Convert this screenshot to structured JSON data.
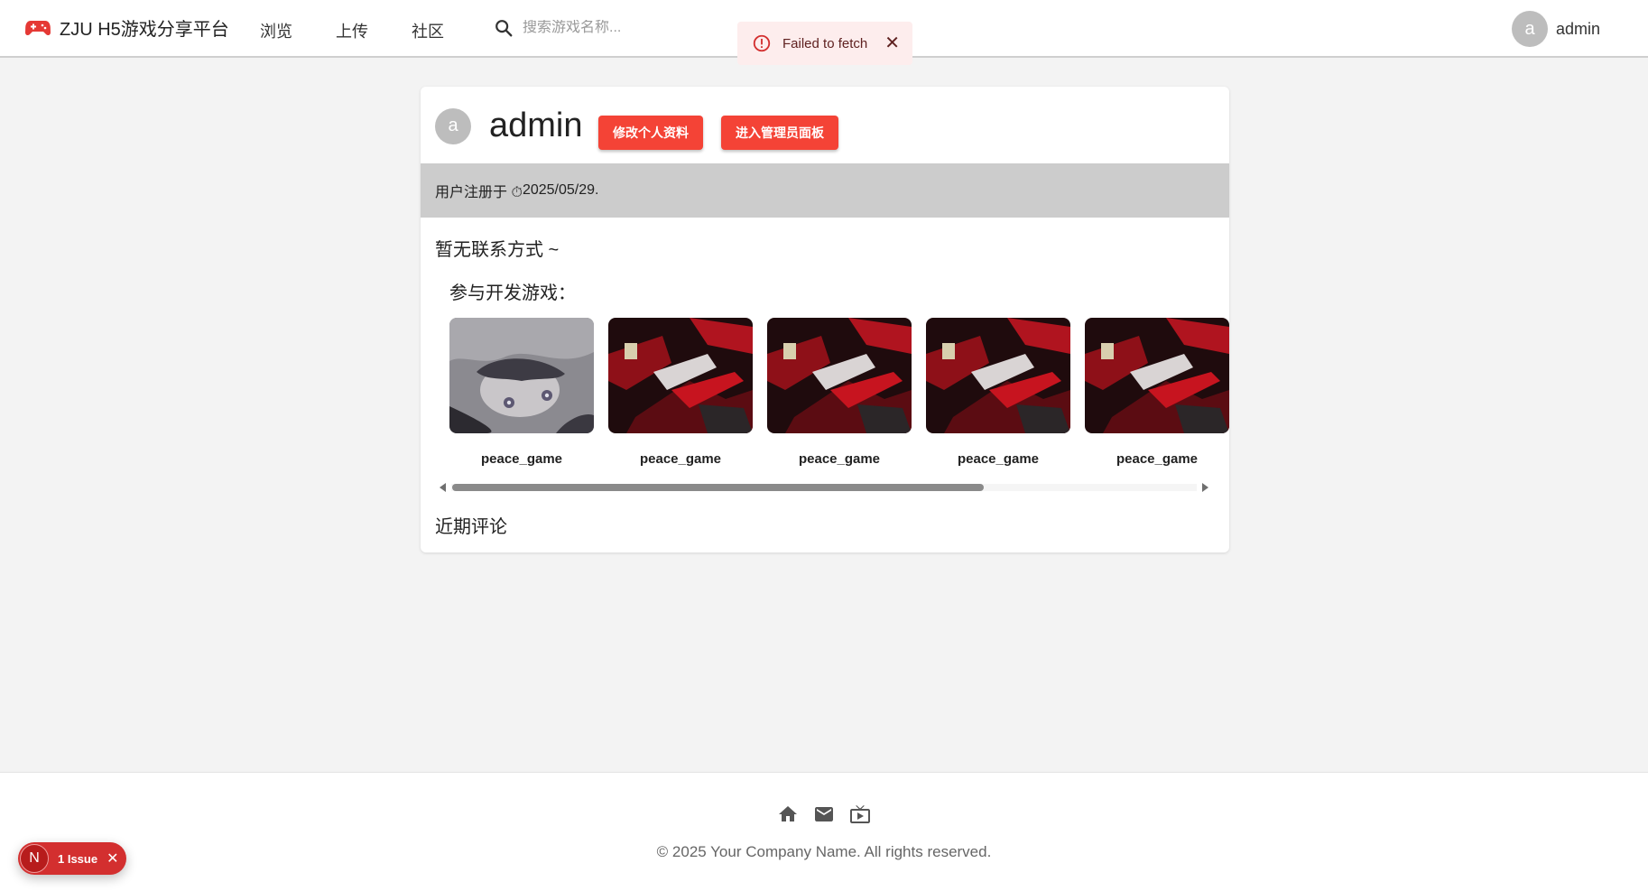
{
  "header": {
    "brand_title": "ZJU H5游戏分享平台",
    "nav": [
      "浏览",
      "上传",
      "社区"
    ],
    "search_placeholder": "搜索游戏名称...",
    "avatar_letter": "a",
    "username": "admin"
  },
  "toast": {
    "message": "Failed to fetch",
    "severity": "error",
    "close_symbol": "✕"
  },
  "profile": {
    "avatar_letter": "a",
    "name": "admin",
    "edit_button": "修改个人资料",
    "admin_button": "进入管理员面板",
    "registered_prefix": "用户注册于 ⏱ ",
    "registered_date": "2025/05/29.",
    "no_contact": "暂无联系方式 ~",
    "games_heading": "参与开发游戏：",
    "games": [
      {
        "title": "peace_game",
        "thumb": "pale-character-art"
      },
      {
        "title": "peace_game",
        "thumb": "red-dark-art"
      },
      {
        "title": "peace_game",
        "thumb": "red-dark-art"
      },
      {
        "title": "peace_game",
        "thumb": "red-dark-art"
      },
      {
        "title": "peace_game",
        "thumb": "red-dark-art"
      }
    ],
    "comments_heading": "近期评论",
    "games_scroll_position": 0.0
  },
  "footer": {
    "icons": [
      "home-icon",
      "mail-icon",
      "tv-icon"
    ],
    "copyright": "© 2025 Your Company Name. All rights reserved."
  },
  "issue_badge": {
    "letter": "N",
    "label": "1 Issue",
    "close_symbol": "✕"
  },
  "colors": {
    "accent": "#f44336",
    "brand_icon": "#e53935",
    "toast_bg": "#fdeded",
    "toast_text": "#5f2120",
    "issue_pill": "#d32f2f",
    "page_bg": "#f3f3f3",
    "band_bg": "#cccccc"
  }
}
